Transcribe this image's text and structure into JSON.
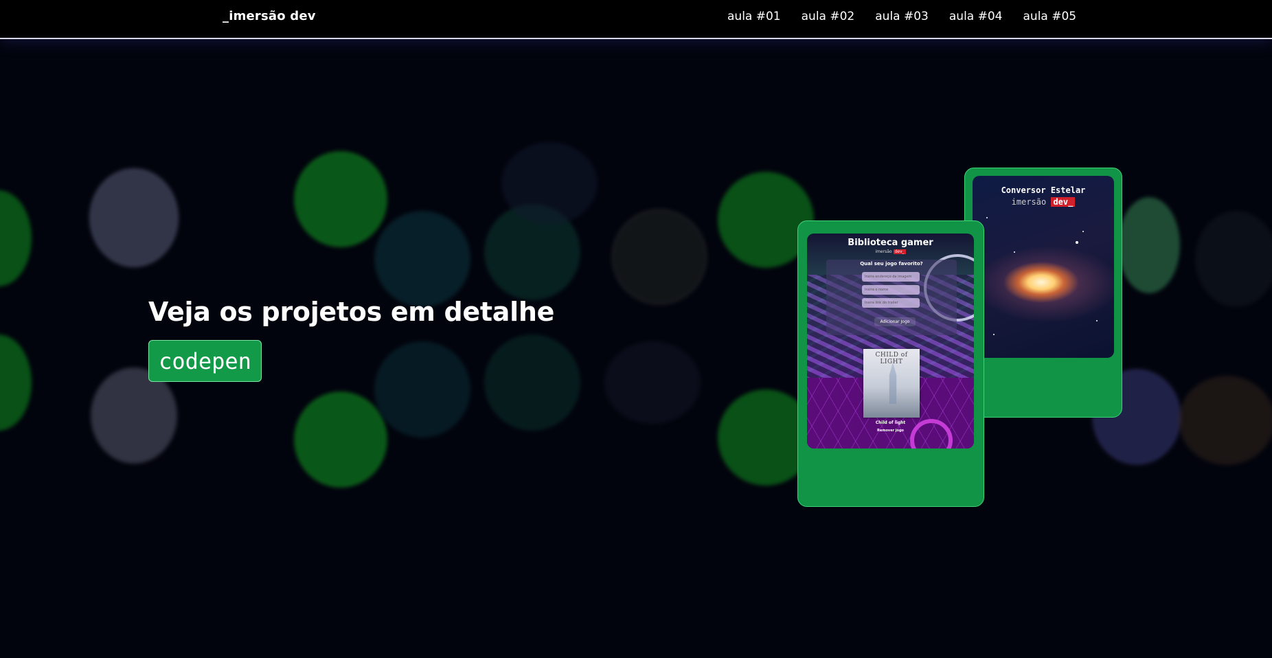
{
  "navbar": {
    "brand": "_imersão dev",
    "links": [
      "aula #01",
      "aula #02",
      "aula #03",
      "aula #04",
      "aula #05"
    ]
  },
  "hero": {
    "title": "Veja os projetos em detalhe",
    "button_label": "codepen"
  },
  "projects": [
    {
      "screenshot_title": "Conversor Estelar",
      "screenshot_subtitle_prefix": "imersão",
      "screenshot_subtitle_tag": "dev_"
    },
    {
      "screenshot_title": "Biblioteca gamer",
      "screenshot_subtitle_prefix": "imersão",
      "screenshot_subtitle_tag": "dev_",
      "form_question": "Qual seu jogo favorito?",
      "inputs": [
        "Insira endereço da imagem",
        "Insira o nome",
        "Insira link do trailer"
      ],
      "submit_label": "Adicionar Jogo",
      "cover_text": "CHILD of LIGHT",
      "game_name": "Child of light",
      "remove_label": "Remover jogo"
    }
  ],
  "colors": {
    "background": "#02040d",
    "navbar": "#000000",
    "accent_green": "#129447",
    "codepen_green": "#139a48",
    "dev_tag_red": "#d11f2c"
  }
}
